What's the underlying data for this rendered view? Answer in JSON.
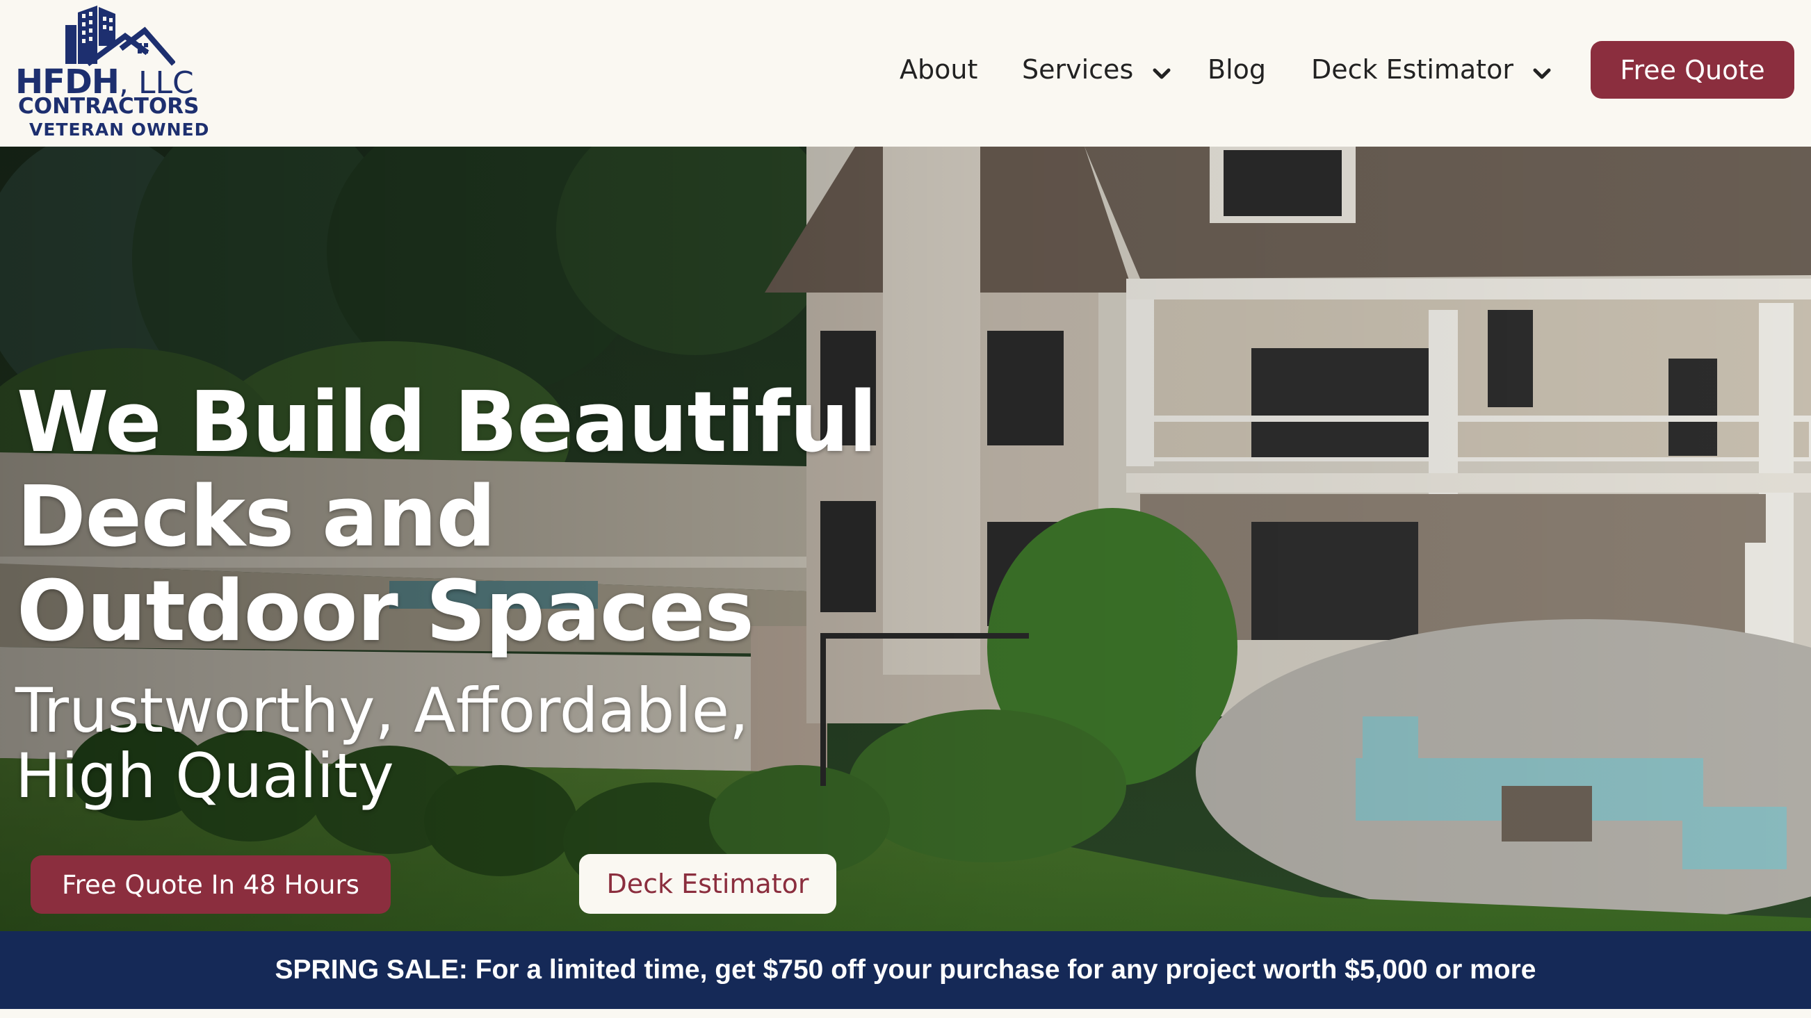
{
  "brand": {
    "name": "HFDH",
    "suffix": ", LLC",
    "line2": "CONTRACTORS",
    "line3": "VETERAN OWNED",
    "color": "#1d2f6f"
  },
  "nav": {
    "items": [
      {
        "label": "About",
        "icon": null
      },
      {
        "label": "Services",
        "icon": "chevron-down-icon"
      },
      {
        "label": "Blog",
        "icon": null
      },
      {
        "label": "Deck Estimator",
        "icon": "chevron-down-icon"
      }
    ],
    "cta_label": "Free Quote"
  },
  "hero": {
    "title": "We Build Beautiful Decks and Outdoor Spaces",
    "subtitle": "Trustworthy, Affordable, High Quality",
    "primary_button": "Free Quote In 48 Hours",
    "secondary_button": "Deck Estimator"
  },
  "promo": {
    "text": "SPRING SALE: For a limited time, get $750 off your purchase for any project worth $5,000 or more"
  },
  "colors": {
    "accent": "#8b2e3e",
    "navy": "#152957",
    "background": "#faf8f2"
  }
}
